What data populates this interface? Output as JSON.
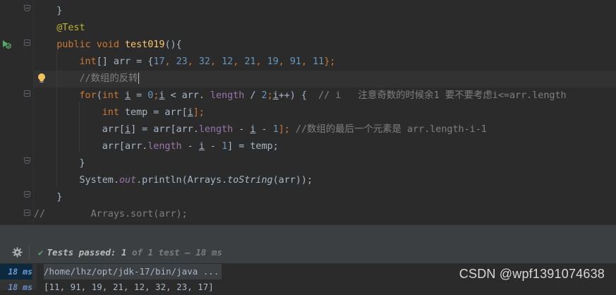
{
  "editor": {
    "lines": [
      [
        {
          "t": "    }",
          "c": ""
        }
      ],
      [
        {
          "t": "    @Test",
          "c": "t-anno"
        }
      ],
      [
        {
          "t": "    ",
          "c": ""
        },
        {
          "t": "public ",
          "c": "t-kw"
        },
        {
          "t": "void ",
          "c": "t-kw"
        },
        {
          "t": "test019",
          "c": "t-fn"
        },
        {
          "t": "(){",
          "c": ""
        }
      ],
      [
        {
          "t": "        ",
          "c": ""
        },
        {
          "t": "int",
          "c": "t-kw"
        },
        {
          "t": "[] arr = {",
          "c": ""
        },
        {
          "t": "17",
          "c": "t-num"
        },
        {
          "t": ", ",
          "c": "t-kw"
        },
        {
          "t": "23",
          "c": "t-num"
        },
        {
          "t": ", ",
          "c": "t-kw"
        },
        {
          "t": "32",
          "c": "t-num"
        },
        {
          "t": ", ",
          "c": "t-kw"
        },
        {
          "t": "12",
          "c": "t-num"
        },
        {
          "t": ", ",
          "c": "t-kw"
        },
        {
          "t": "21",
          "c": "t-num"
        },
        {
          "t": ", ",
          "c": "t-kw"
        },
        {
          "t": "19",
          "c": "t-num"
        },
        {
          "t": ", ",
          "c": "t-kw"
        },
        {
          "t": "91",
          "c": "t-num"
        },
        {
          "t": ", ",
          "c": "t-kw"
        },
        {
          "t": "11",
          "c": "t-num"
        },
        {
          "t": "};",
          "c": "t-kw"
        }
      ],
      [
        {
          "t": "        //数组的反转",
          "c": "t-cmt"
        }
      ],
      [
        {
          "t": "        ",
          "c": ""
        },
        {
          "t": "for",
          "c": "t-kw"
        },
        {
          "t": "(",
          "c": ""
        },
        {
          "t": "int ",
          "c": "t-kw"
        },
        {
          "t": "i",
          "c": "t-underline"
        },
        {
          "t": " = ",
          "c": ""
        },
        {
          "t": "0",
          "c": "t-num"
        },
        {
          "t": ";",
          "c": "t-kw"
        },
        {
          "t": "i",
          "c": "t-underline"
        },
        {
          "t": " < arr. ",
          "c": ""
        },
        {
          "t": "length",
          "c": "t-field"
        },
        {
          "t": " / ",
          "c": ""
        },
        {
          "t": "2",
          "c": "t-num"
        },
        {
          "t": ";",
          "c": "t-kw"
        },
        {
          "t": "i",
          "c": "t-underline"
        },
        {
          "t": "++) {  ",
          "c": ""
        },
        {
          "t": "// i   注意奇数的时候余1 要不要考虑i<=arr.length",
          "c": "t-cmt"
        }
      ],
      [
        {
          "t": "            ",
          "c": ""
        },
        {
          "t": "int ",
          "c": "t-kw"
        },
        {
          "t": "temp = arr[",
          "c": ""
        },
        {
          "t": "i",
          "c": "t-underline"
        },
        {
          "t": "];",
          "c": "t-kw"
        }
      ],
      [
        {
          "t": "            arr[",
          "c": ""
        },
        {
          "t": "i",
          "c": "t-underline"
        },
        {
          "t": "] = arr[arr.",
          "c": ""
        },
        {
          "t": "length",
          "c": "t-field"
        },
        {
          "t": " - ",
          "c": ""
        },
        {
          "t": "i",
          "c": "t-underline"
        },
        {
          "t": " - ",
          "c": ""
        },
        {
          "t": "1",
          "c": "t-num"
        },
        {
          "t": "]; ",
          "c": "t-kw"
        },
        {
          "t": "//数组的最后一个元素是 arr.length-i-1",
          "c": "t-cmt"
        }
      ],
      [
        {
          "t": "            arr[arr.",
          "c": ""
        },
        {
          "t": "length",
          "c": "t-field"
        },
        {
          "t": " - ",
          "c": ""
        },
        {
          "t": "i",
          "c": "t-underline"
        },
        {
          "t": " - ",
          "c": ""
        },
        {
          "t": "1",
          "c": "t-num"
        },
        {
          "t": "] = temp;",
          "c": ""
        }
      ],
      [
        {
          "t": "        }",
          "c": ""
        }
      ],
      [
        {
          "t": "        System.",
          "c": ""
        },
        {
          "t": "out",
          "c": "t-field t-ital"
        },
        {
          "t": ".println(Arrays.",
          "c": ""
        },
        {
          "t": "toString",
          "c": "t-ital"
        },
        {
          "t": "(arr));",
          "c": ""
        }
      ],
      [
        {
          "t": "    }",
          "c": ""
        }
      ],
      [
        {
          "t": "//        Arrays.sort(arr);",
          "c": "t-cmt"
        }
      ]
    ]
  },
  "run_panel": {
    "status_check": "✔",
    "status_label": "Tests passed: ",
    "passed_count": "1",
    "of_text": " of ",
    "total_text": "1 test",
    "duration_sep": " – ",
    "duration": "18 ms"
  },
  "console": {
    "rows": [
      {
        "time": "18 ms",
        "text": "/home/lhz/opt/jdk-17/bin/java ..."
      },
      {
        "time": "18 ms",
        "text": "[11, 91, 19, 21, 12, 32, 23, 17]"
      }
    ]
  },
  "watermark": "CSDN @wpf1391074638",
  "colors": {
    "background": "#2b2b2b",
    "keyword": "#cc7832",
    "method": "#ffc66d",
    "number": "#6897bb",
    "annotation": "#bbb529",
    "comment": "#808080",
    "field": "#9876aa",
    "pass_green": "#59a869"
  },
  "icons": {
    "run": "run-test-icon",
    "bulb": "lightbulb-icon",
    "gear": "gear-icon",
    "check": "check-icon"
  }
}
